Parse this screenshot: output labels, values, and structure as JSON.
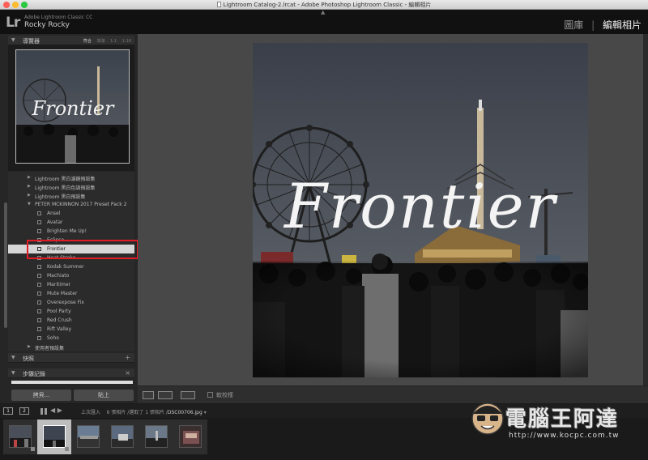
{
  "window": {
    "title": "Lightroom Catalog-2.lrcat - Adobe Photoshop Lightroom Classic - 編輯相片"
  },
  "identity": {
    "logo": "Lr",
    "app_name": "Adobe Lightroom Classic CC",
    "user_name": "Rocky Rocky",
    "modules": [
      "圖庫",
      "編輯相片"
    ],
    "module_sep": "|",
    "active_module": "編輯相片"
  },
  "navigator": {
    "title": "導覽器",
    "zoom_options": [
      "符合",
      "填滿",
      "1:1",
      "1:16"
    ],
    "active_zoom": "符合",
    "preview_text": "Frontier"
  },
  "presets": {
    "groups_before": [
      "Lightroom 黑白濾鏡預設集",
      "Lightroom 黑白色調預設集",
      "Lightroom 黑白預設集"
    ],
    "open_group": "PETER MCKINNON 2017 Preset Pack 2",
    "items": [
      "Ansel",
      "Avatar",
      "Brighten Me Up!",
      "Eclipse",
      "Frontier",
      "Heat Stroke",
      "Kodak Summer",
      "Machiato",
      "Maritimer",
      "Mute Master",
      "Overexpose Fix",
      "Pool Party",
      "Red Crush",
      "Rift Valley",
      "Soho"
    ],
    "selected_item": "Frontier",
    "user_group": "使用者預設集"
  },
  "panels": {
    "snapshots": "快照",
    "history": "步驟記錄"
  },
  "buttons": {
    "copy": "拷貝...",
    "paste": "貼上"
  },
  "toolbar": {
    "soft_proof": "軟校樣"
  },
  "filmstrip": {
    "monitor_1": "1",
    "monitor_2": "2",
    "source": "上次匯入",
    "info_prefix": "6 張相片 /選取了 1 張相片 /",
    "filename": "DSC00706.jpg",
    "thumb_count": 6,
    "selected_index": 1
  },
  "photo": {
    "overlay_text": "Frontier"
  },
  "watermark": {
    "title": "電腦王阿達",
    "url": "http://www.kocpc.com.tw"
  },
  "colors": {
    "highlight": "#e21c24",
    "sky": "#4a4e58",
    "crowd": "#141414"
  }
}
